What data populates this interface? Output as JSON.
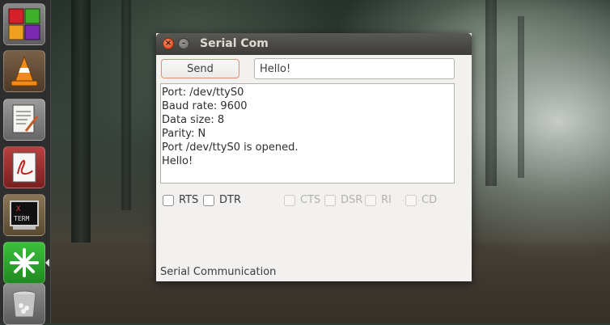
{
  "window": {
    "title": "Serial Com",
    "close_glyph": "×",
    "minimize_glyph": "–"
  },
  "toolbar": {
    "send_label": "Send",
    "message_value": "Hello!"
  },
  "log": {
    "lines": [
      "Port: /dev/ttyS0",
      "Baud rate: 9600",
      "Data size: 8",
      "Parity: N",
      "Port /dev/ttyS0 is opened.",
      "Hello!"
    ]
  },
  "signals": {
    "rts": {
      "label": "RTS",
      "checked": false,
      "enabled": true
    },
    "dtr": {
      "label": "DTR",
      "checked": false,
      "enabled": true
    },
    "cts": {
      "label": "CTS",
      "checked": false,
      "enabled": false
    },
    "dsr": {
      "label": "DSR",
      "checked": false,
      "enabled": false
    },
    "ri": {
      "label": "RI",
      "checked": false,
      "enabled": false
    },
    "cd": {
      "label": "CD",
      "checked": false,
      "enabled": false
    }
  },
  "status": {
    "text": "Serial Communication"
  },
  "launcher": {
    "items": [
      {
        "icon": "app-grid-icon"
      },
      {
        "icon": "vlc-cone-icon"
      },
      {
        "icon": "text-editor-icon"
      },
      {
        "icon": "pdf-reader-icon"
      },
      {
        "icon": "xterm-icon",
        "label_top": "X",
        "label_bottom": "TERM"
      },
      {
        "icon": "asterisk-app-icon",
        "active": true
      },
      {
        "icon": "trash-icon"
      }
    ]
  }
}
